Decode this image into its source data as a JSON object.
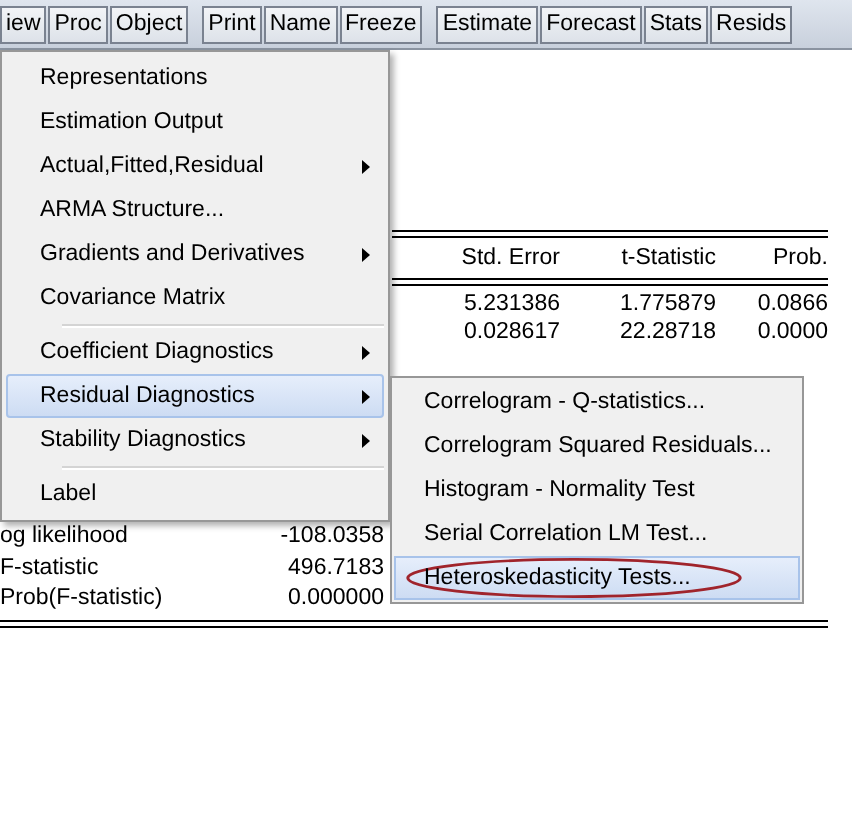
{
  "toolbar": [
    [
      "iew",
      "Proc",
      "Object"
    ],
    [
      "Print",
      "Name",
      "Freeze"
    ],
    [
      "Estimate",
      "Forecast",
      "Stats",
      "Resids"
    ]
  ],
  "output": {
    "columns": [
      "Std. Error",
      "t-Statistic",
      "Prob."
    ],
    "rows": [
      [
        "5.231386",
        "1.775879",
        "0.0866"
      ],
      [
        "0.028617",
        "22.28718",
        "0.0000"
      ]
    ],
    "stats": [
      {
        "label": "og likelihood",
        "value": "-108.0358"
      },
      {
        "label": "F-statistic",
        "value": "496.7183"
      },
      {
        "label": "Prob(F-statistic)",
        "value": "0.000000"
      }
    ]
  },
  "menu": {
    "items": [
      {
        "kind": "item",
        "label": "Representations",
        "has_submenu": false,
        "selected": false
      },
      {
        "kind": "item",
        "label": "Estimation Output",
        "has_submenu": false,
        "selected": false
      },
      {
        "kind": "item",
        "label": "Actual,Fitted,Residual",
        "has_submenu": true,
        "selected": false
      },
      {
        "kind": "item",
        "label": "ARMA Structure...",
        "has_submenu": false,
        "selected": false
      },
      {
        "kind": "item",
        "label": "Gradients and Derivatives",
        "has_submenu": true,
        "selected": false
      },
      {
        "kind": "item",
        "label": "Covariance Matrix",
        "has_submenu": false,
        "selected": false
      },
      {
        "kind": "separator"
      },
      {
        "kind": "item",
        "label": "Coefficient Diagnostics",
        "has_submenu": true,
        "selected": false
      },
      {
        "kind": "item",
        "label": "Residual Diagnostics",
        "has_submenu": true,
        "selected": true
      },
      {
        "kind": "item",
        "label": "Stability Diagnostics",
        "has_submenu": true,
        "selected": false
      },
      {
        "kind": "separator"
      },
      {
        "kind": "item",
        "label": "Label",
        "has_submenu": false,
        "selected": false
      }
    ]
  },
  "submenu": {
    "items": [
      {
        "label": "Correlogram - Q-statistics...",
        "selected": false,
        "circled": false
      },
      {
        "label": "Correlogram Squared Residuals...",
        "selected": false,
        "circled": false
      },
      {
        "label": "Histogram - Normality Test",
        "selected": false,
        "circled": false
      },
      {
        "label": "Serial Correlation LM Test...",
        "selected": false,
        "circled": false
      },
      {
        "label": "Heteroskedasticity Tests...",
        "selected": true,
        "circled": true
      }
    ]
  }
}
